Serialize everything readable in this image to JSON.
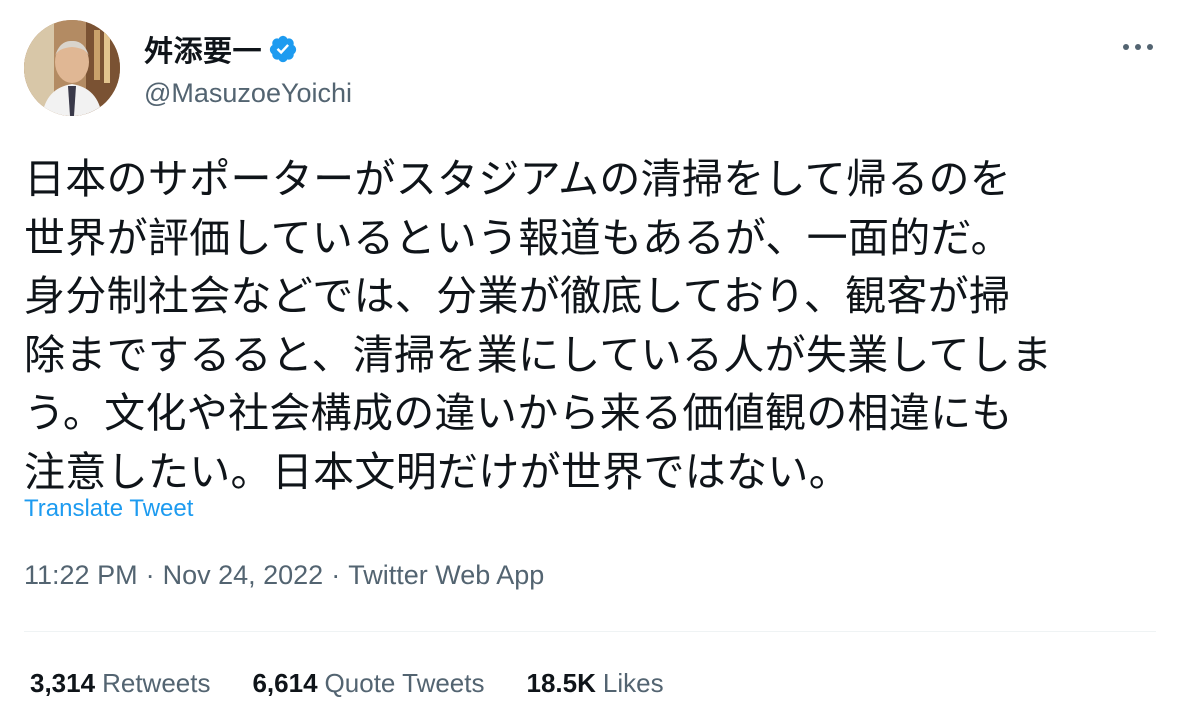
{
  "author": {
    "display_name": "舛添要一",
    "handle": "@MasuzoeYoichi",
    "verified": true,
    "avatar_icon": "profile-photo"
  },
  "more_icon": "more-horizontal-icon",
  "tweet": {
    "text": "日本のサポーターがスタジアムの清掃をして帰るのを\n世界が評価しているという報道もあるが、一面的だ。\n身分制社会などでは、分業が徹底しており、観客が掃\n除までするると、清掃を業にしている人が失業してしま\nう。文化や社会構成の違いから来る価値観の相違にも\n注意したい。日本文明だけが世界ではない。",
    "translate_label": "Translate Tweet"
  },
  "meta": {
    "time": "11:22 PM",
    "separator": "·",
    "date": "Nov 24, 2022",
    "source": "Twitter Web App"
  },
  "stats": {
    "retweets_count": "3,314",
    "retweets_label": "Retweets",
    "quotes_count": "6,614",
    "quotes_label": "Quote Tweets",
    "likes_count": "18.5K",
    "likes_label": "Likes"
  },
  "colors": {
    "accent": "#1d9bf0",
    "text": "#0f1419",
    "secondary": "#536471",
    "divider": "#eff3f4"
  }
}
